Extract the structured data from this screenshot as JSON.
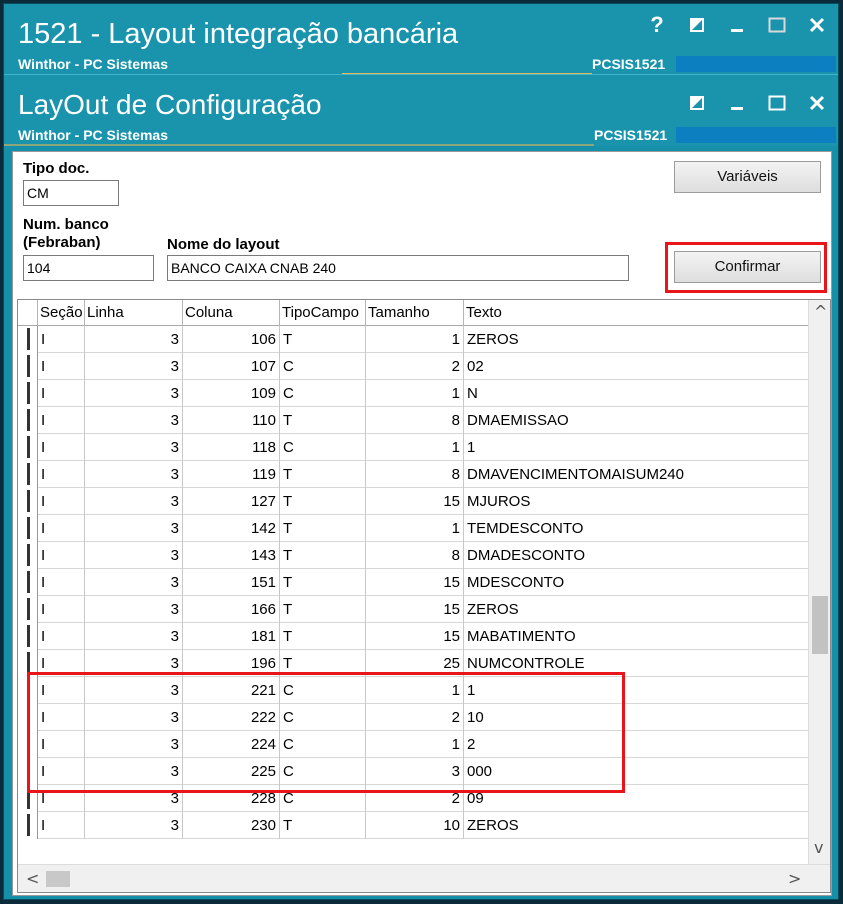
{
  "window1": {
    "title": "1521 - Layout integração bancária",
    "subtitle": "Winthor - PC Sistemas",
    "code": "PCSIS1521",
    "buttons": [
      "help-icon",
      "restore-icon",
      "minimize-icon",
      "maximize-icon",
      "close-icon"
    ],
    "help_label": "?"
  },
  "window2": {
    "title": "LayOut de Configuração",
    "subtitle": "Winthor - PC Sistemas",
    "code": "PCSIS1521",
    "buttons": [
      "restore-icon",
      "minimize-icon",
      "maximize-icon",
      "close-icon"
    ]
  },
  "form": {
    "tipo_doc_label": "Tipo doc.",
    "tipo_doc_value": "CM",
    "num_banco_label_line1": "Num. banco",
    "num_banco_label_line2": "(Febraban)",
    "num_banco_value": "104",
    "nome_layout_label": "Nome do layout",
    "nome_layout_value": "BANCO CAIXA CNAB 240",
    "variaveis_button": "Variáveis",
    "confirmar_button": "Confirmar"
  },
  "grid": {
    "columns": [
      "Seção",
      "Linha",
      "Coluna",
      "TipoCampo",
      "Tamanho",
      "Texto"
    ],
    "rows": [
      [
        "I",
        "3",
        "106",
        "T",
        "1",
        "ZEROS"
      ],
      [
        "I",
        "3",
        "107",
        "C",
        "2",
        "02"
      ],
      [
        "I",
        "3",
        "109",
        "C",
        "1",
        "N"
      ],
      [
        "I",
        "3",
        "110",
        "T",
        "8",
        "DMAEMISSAO"
      ],
      [
        "I",
        "3",
        "118",
        "C",
        "1",
        "1"
      ],
      [
        "I",
        "3",
        "119",
        "T",
        "8",
        "DMAVENCIMENTOMAISUM240"
      ],
      [
        "I",
        "3",
        "127",
        "T",
        "15",
        "MJUROS"
      ],
      [
        "I",
        "3",
        "142",
        "T",
        "1",
        "TEMDESCONTO"
      ],
      [
        "I",
        "3",
        "143",
        "T",
        "8",
        "DMADESCONTO"
      ],
      [
        "I",
        "3",
        "151",
        "T",
        "15",
        "MDESCONTO"
      ],
      [
        "I",
        "3",
        "166",
        "T",
        "15",
        "ZEROS"
      ],
      [
        "I",
        "3",
        "181",
        "T",
        "15",
        "MABATIMENTO"
      ],
      [
        "I",
        "3",
        "196",
        "T",
        "25",
        "NUMCONTROLE"
      ],
      [
        "I",
        "3",
        "221",
        "C",
        "1",
        "1"
      ],
      [
        "I",
        "3",
        "222",
        "C",
        "2",
        "10"
      ],
      [
        "I",
        "3",
        "224",
        "C",
        "1",
        "2"
      ],
      [
        "I",
        "3",
        "225",
        "C",
        "3",
        "000"
      ],
      [
        "I",
        "3",
        "228",
        "C",
        "2",
        "09"
      ],
      [
        "I",
        "3",
        "230",
        "T",
        "10",
        "ZEROS"
      ]
    ]
  },
  "scroll": {
    "up_arrow": "^",
    "down_arrow": "v",
    "left_arrow": "<",
    "right_arrow": ">"
  },
  "colors": {
    "titlebar": "#1a93ad",
    "highlight": "#e8161b",
    "accent_line": "#e6b95a"
  }
}
